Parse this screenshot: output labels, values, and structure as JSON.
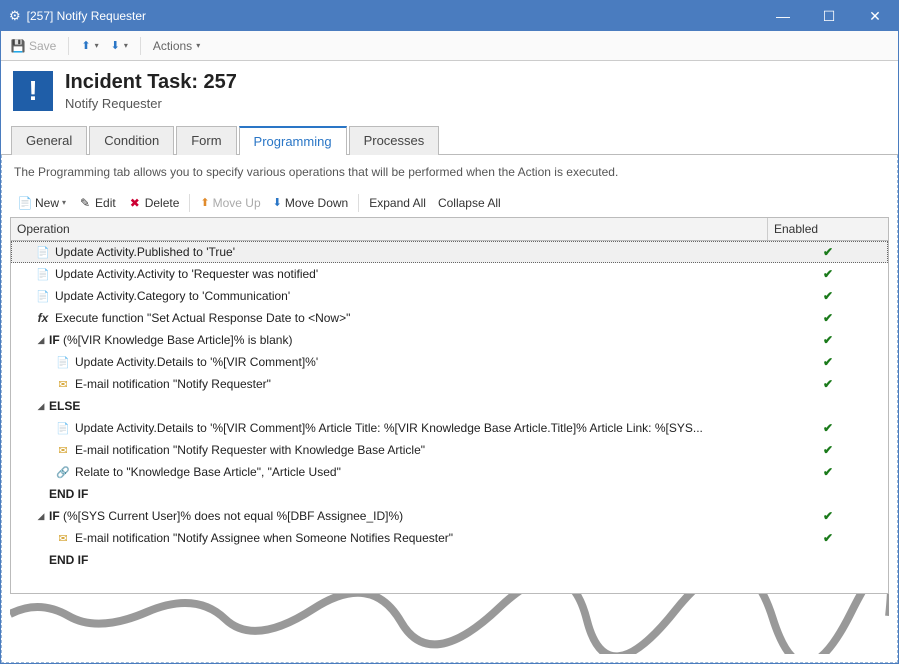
{
  "window": {
    "title": "[257] Notify Requester"
  },
  "toolbar": {
    "save_label": "Save",
    "actions_label": "Actions"
  },
  "header": {
    "title": "Incident Task: 257",
    "subtitle": "Notify Requester"
  },
  "tabs": [
    {
      "label": "General",
      "active": false
    },
    {
      "label": "Condition",
      "active": false
    },
    {
      "label": "Form",
      "active": false
    },
    {
      "label": "Programming",
      "active": true
    },
    {
      "label": "Processes",
      "active": false
    }
  ],
  "description": "The Programming tab allows you to specify various operations that will be performed when the Action is executed.",
  "subtoolbar": {
    "new": "New",
    "edit": "Edit",
    "delete": "Delete",
    "move_up": "Move Up",
    "move_down": "Move Down",
    "expand_all": "Expand All",
    "collapse_all": "Collapse All"
  },
  "grid": {
    "col_operation": "Operation",
    "col_enabled": "Enabled"
  },
  "rows": [
    {
      "indent": 1,
      "icon": "doc",
      "text": "Update Activity.Published to 'True'",
      "enabled": true,
      "bold": false,
      "selected": true
    },
    {
      "indent": 1,
      "icon": "doc",
      "text": "Update Activity.Activity to 'Requester was notified'",
      "enabled": true,
      "bold": false
    },
    {
      "indent": 1,
      "icon": "doc",
      "text": "Update Activity.Category to 'Communication'",
      "enabled": true,
      "bold": false
    },
    {
      "indent": 1,
      "icon": "fx",
      "text": "Execute function \"Set Actual Response Date to <Now>\"",
      "enabled": true,
      "bold": false
    },
    {
      "indent": 1,
      "icon": "",
      "text": "IF (%[VIR Knowledge Base Article]% is blank)",
      "enabled": true,
      "bold": true,
      "expander": true
    },
    {
      "indent": 2,
      "icon": "doc",
      "text": "Update Activity.Details to '%[VIR Comment]%'",
      "enabled": true,
      "bold": false
    },
    {
      "indent": 2,
      "icon": "mail",
      "text": "E-mail notification \"Notify Requester\"",
      "enabled": true,
      "bold": false
    },
    {
      "indent": 1,
      "icon": "",
      "text": "ELSE",
      "enabled": null,
      "bold": true,
      "expander": true
    },
    {
      "indent": 2,
      "icon": "doc",
      "text": "Update Activity.Details to '%[VIR Comment]% Article Title: %[VIR Knowledge Base Article.Title]% Article Link: %[SYS...",
      "enabled": true,
      "bold": false
    },
    {
      "indent": 2,
      "icon": "mail",
      "text": "E-mail notification \"Notify Requester with Knowledge Base Article\"",
      "enabled": true,
      "bold": false
    },
    {
      "indent": 2,
      "icon": "rel",
      "text": "Relate to \"Knowledge Base Article\", \"Article Used\"",
      "enabled": true,
      "bold": false
    },
    {
      "indent": 1,
      "icon": "",
      "text": "END IF",
      "enabled": null,
      "bold": true
    },
    {
      "indent": 1,
      "icon": "",
      "text": "IF (%[SYS Current User]% does not equal %[DBF Assignee_ID]%)",
      "enabled": true,
      "bold": true,
      "expander": true
    },
    {
      "indent": 2,
      "icon": "mail",
      "text": "E-mail notification \"Notify Assignee when Someone Notifies Requester\"",
      "enabled": true,
      "bold": false
    },
    {
      "indent": 1,
      "icon": "",
      "text": "END IF",
      "enabled": null,
      "bold": true
    }
  ]
}
